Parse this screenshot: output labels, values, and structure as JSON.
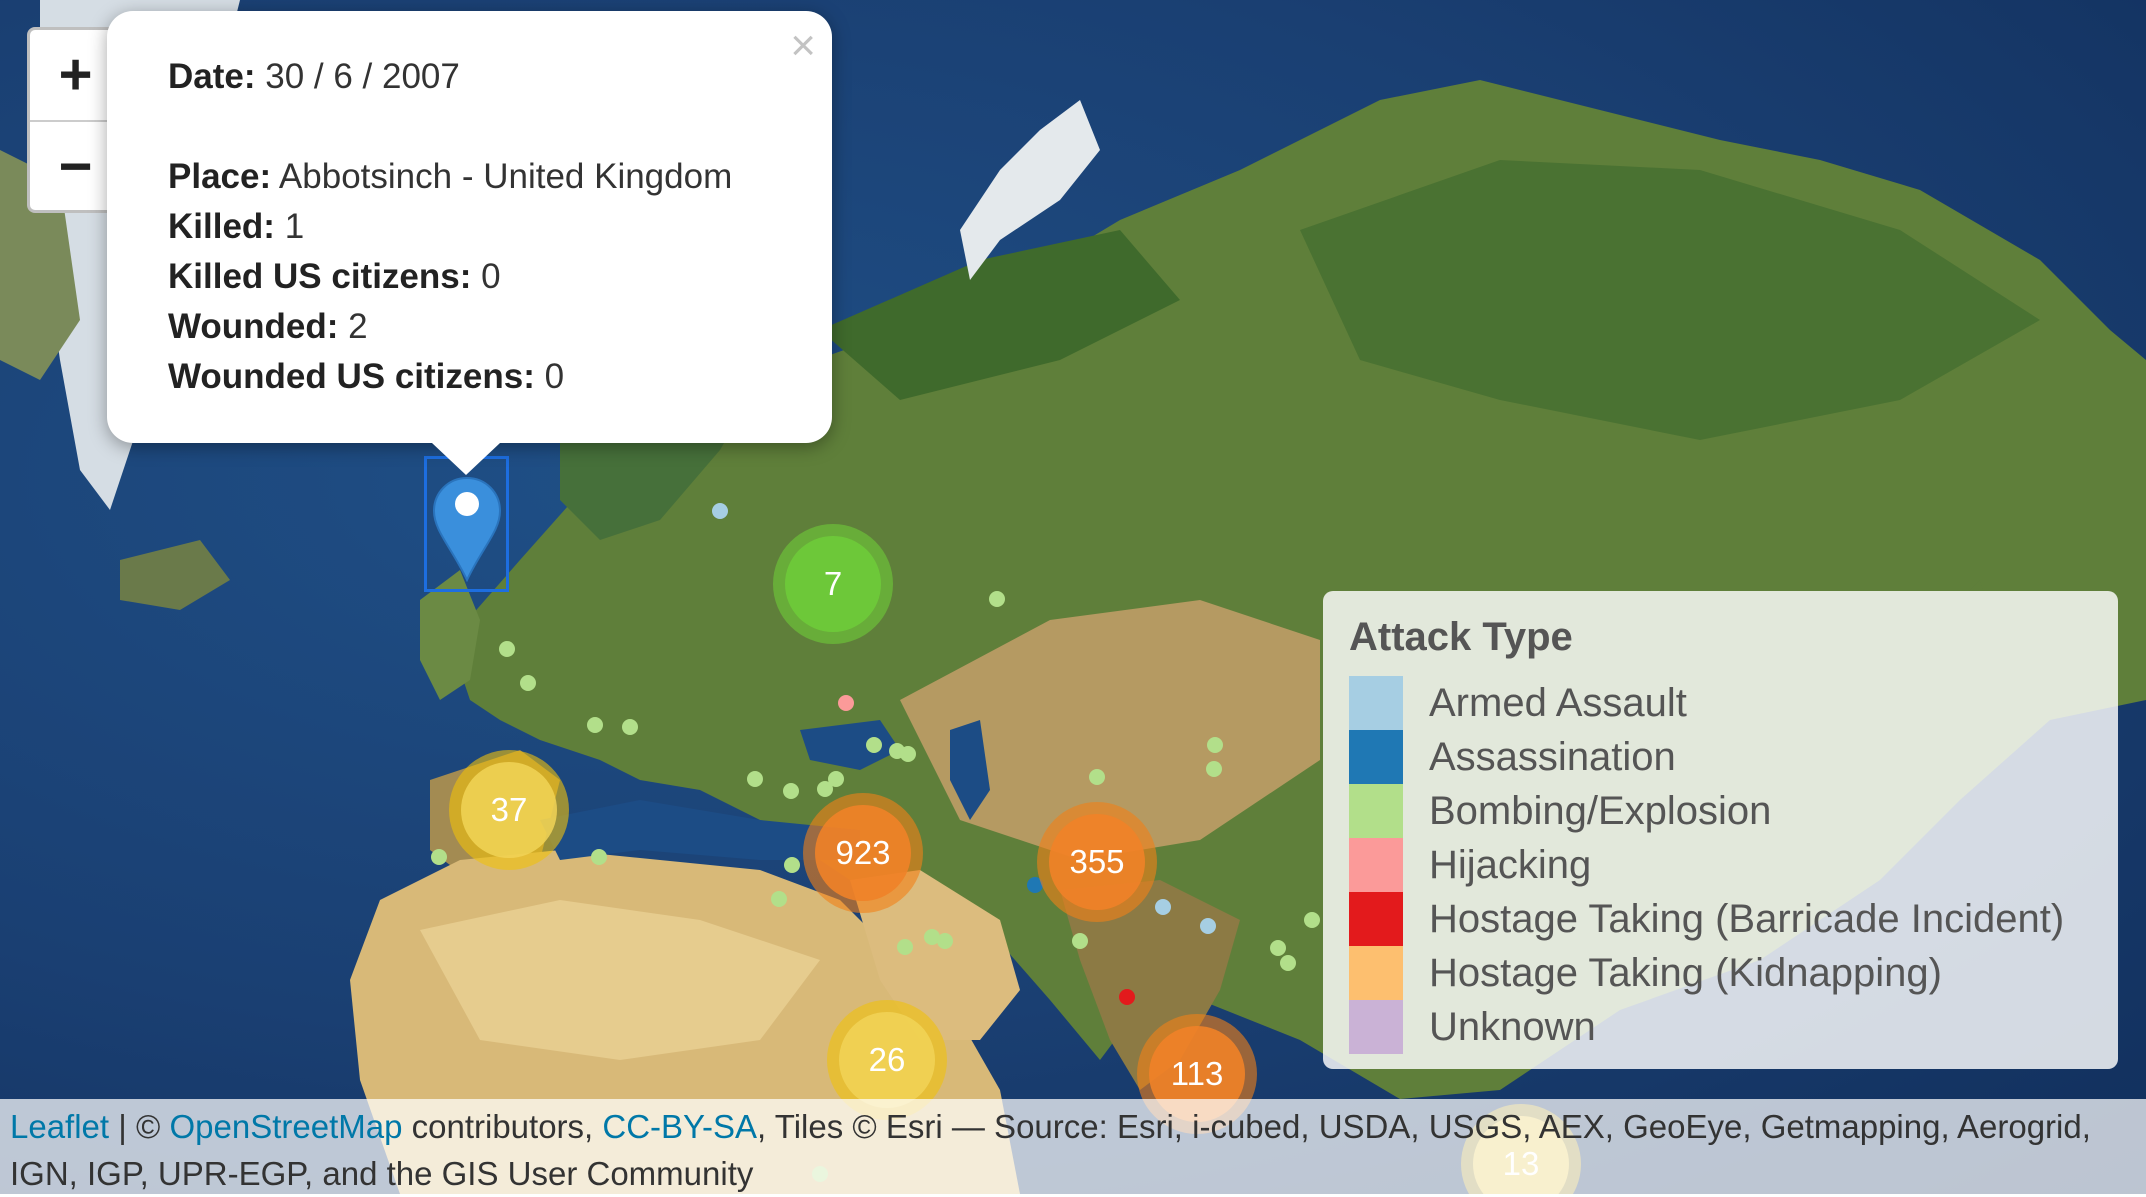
{
  "zoom": {
    "in_label": "+",
    "out_label": "−"
  },
  "popup": {
    "close_label": "×",
    "date_label": "Date:",
    "date_value": "30 / 6 / 2007",
    "place_label": "Place:",
    "place_value": "Abbotsinch - United Kingdom",
    "killed_label": "Killed:",
    "killed_value": "1",
    "killed_us_label": "Killed US citizens:",
    "killed_us_value": "0",
    "wounded_label": "Wounded:",
    "wounded_value": "2",
    "wounded_us_label": "Wounded US citizens:",
    "wounded_us_value": "0"
  },
  "clusters": [
    {
      "id": "c7",
      "count": "7",
      "color": "green"
    },
    {
      "id": "c37",
      "count": "37",
      "color": "yellow"
    },
    {
      "id": "c923",
      "count": "923",
      "color": "orange"
    },
    {
      "id": "c355",
      "count": "355",
      "color": "orange"
    },
    {
      "id": "c26",
      "count": "26",
      "color": "yellow"
    },
    {
      "id": "c113",
      "count": "113",
      "color": "orange"
    },
    {
      "id": "c13",
      "count": "13",
      "color": "yellow"
    }
  ],
  "legend": {
    "title": "Attack Type",
    "items": [
      {
        "label": "Armed Assault",
        "color": "#a6cee3"
      },
      {
        "label": "Assassination",
        "color": "#1f78b4"
      },
      {
        "label": "Bombing/Explosion",
        "color": "#b2df8a"
      },
      {
        "label": "Hijacking",
        "color": "#fb9a99"
      },
      {
        "label": "Hostage Taking (Barricade Incident)",
        "color": "#e31a1c"
      },
      {
        "label": "Hostage Taking (Kidnapping)",
        "color": "#fdbf6f"
      },
      {
        "label": "Unknown",
        "color": "#cab2d6"
      }
    ]
  },
  "attribution": {
    "leaflet": "Leaflet",
    "sep": " | © ",
    "osm": "OpenStreetMap",
    "contrib": " contributors, ",
    "license": "CC-BY-SA",
    "rest": ", Tiles © Esri — Source: Esri, i-cubed, USDA, USGS, AEX, GeoEye, Getmapping, Aerogrid, IGN, IGP, UPR-EGP, and the GIS User Community"
  }
}
